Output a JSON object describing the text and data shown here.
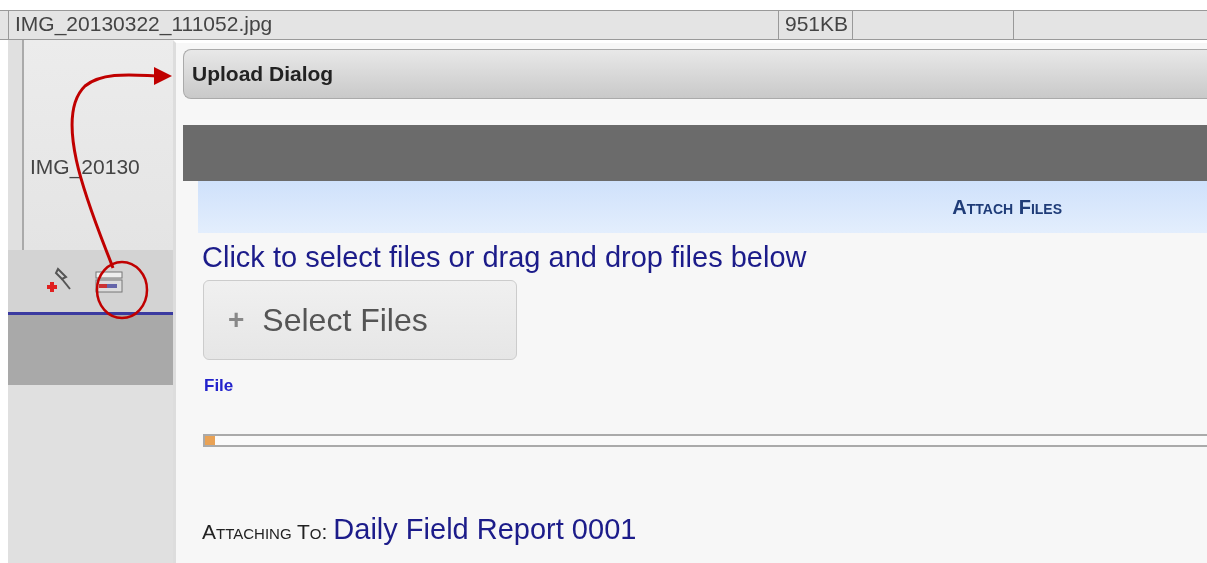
{
  "file_list": {
    "rows": [
      {
        "name": "IMG_20130322_111052.jpg",
        "size": "951KB"
      },
      {
        "name": "IMG_20130"
      }
    ]
  },
  "dialog": {
    "title": "Upload Dialog",
    "section_header": "Attach Files",
    "instruction": "Click to select files or drag and drop files below",
    "select_button": "Select Files",
    "select_icon": "+",
    "file_column": "File",
    "progress": {
      "level": 0.01
    },
    "attaching_label": "Attaching To:",
    "attaching_value": "Daily Field Report 0001"
  }
}
